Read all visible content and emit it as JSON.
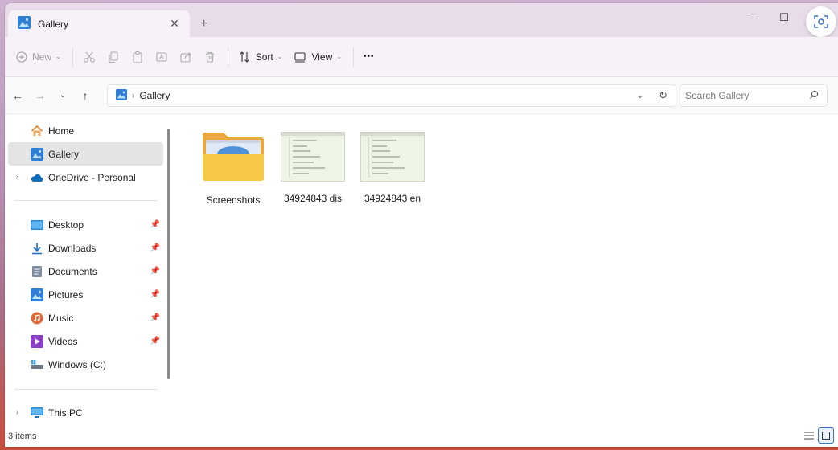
{
  "tab": {
    "title": "Gallery",
    "close_symbol": "✕",
    "new_tab_symbol": "+"
  },
  "window_controls": {
    "minimize": "—",
    "maximize": "☐"
  },
  "toolbar": {
    "new_label": "New",
    "sort_label": "Sort",
    "view_label": "View",
    "more_label": "•••"
  },
  "address": {
    "crumbs": [
      "Gallery"
    ],
    "search_placeholder": "Search Gallery"
  },
  "sidebar": {
    "top_items": [
      {
        "label": "Home",
        "icon": "home-icon"
      },
      {
        "label": "Gallery",
        "icon": "gallery-icon"
      },
      {
        "label": "OneDrive - Personal",
        "icon": "onedrive-icon"
      }
    ],
    "pinned_items": [
      {
        "label": "Desktop",
        "icon": "desktop-icon"
      },
      {
        "label": "Downloads",
        "icon": "downloads-icon"
      },
      {
        "label": "Documents",
        "icon": "documents-icon"
      },
      {
        "label": "Pictures",
        "icon": "pictures-icon"
      },
      {
        "label": "Music",
        "icon": "music-icon"
      },
      {
        "label": "Videos",
        "icon": "videos-icon"
      },
      {
        "label": "Windows (C:)",
        "icon": "drive-icon"
      }
    ],
    "bottom_items": [
      {
        "label": "This PC",
        "icon": "this-pc-icon"
      }
    ]
  },
  "content": {
    "items": [
      {
        "name": "Screenshots",
        "kind": "folder"
      },
      {
        "name": "34924843 dis",
        "kind": "image"
      },
      {
        "name": "34924843 en",
        "kind": "image"
      }
    ]
  },
  "status": {
    "item_count": "3 items"
  },
  "colors": {
    "accent": "#0067c0",
    "folder": "#f7c948",
    "selected": "#e4e4e4"
  }
}
